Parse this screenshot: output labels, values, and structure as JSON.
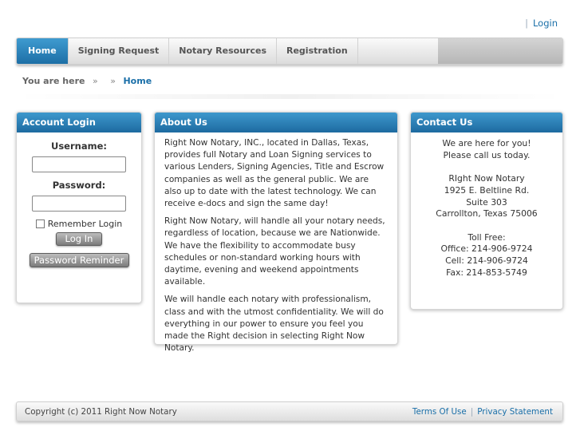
{
  "top_links": {
    "login": "Login"
  },
  "nav": {
    "tabs": [
      {
        "label": "Home",
        "active": true
      },
      {
        "label": "Signing Request",
        "active": false
      },
      {
        "label": "Notary Resources",
        "active": false
      },
      {
        "label": "Registration",
        "active": false
      }
    ]
  },
  "breadcrumb": {
    "label": "You are here",
    "separator": "»",
    "current": "Home"
  },
  "login_box": {
    "title": "Account Login",
    "username_label": "Username:",
    "username_value": "",
    "password_label": "Password:",
    "password_value": "",
    "remember_label": "Remember Login",
    "login_button": "Log In",
    "reminder_button": "Password Reminder"
  },
  "about_box": {
    "title": "About Us",
    "paragraphs": [
      "Right Now Notary, INC., located in Dallas, Texas, provides full Notary and Loan Signing services to various Lenders, Signing Agencies, Title and Escrow companies as well as the general public. We are also up to date with the latest technology. We can receive e-docs and sign the same day!",
      "Right Now Notary, will handle all your notary needs, regardless of location, because we are Nationwide. We have the flexibility to accommodate busy schedules or non-standard working hours with daytime, evening and weekend appointments available.",
      "We will handle each notary with professionalism, class and with the utmost confidentiality. We will do everything in our power to ensure you feel you made the Right decision in selecting Right Now Notary."
    ]
  },
  "contact_box": {
    "title": "Contact Us",
    "line1": "We are here for you!",
    "line2": "Please call us today.",
    "company": "RIght Now Notary",
    "address1": "1925 E. Beltline Rd.",
    "address2": "Suite 303",
    "city": "Carrollton, Texas 75006",
    "toll_label": "Toll Free:",
    "office": "Office: 214-906-9724",
    "cell": "Cell: 214-906-9724",
    "fax": "Fax: 214-853-5749"
  },
  "footer": {
    "copyright": "Copyright (c) 2011 Right Now Notary",
    "terms": "Terms Of Use",
    "privacy": "Privacy Statement"
  },
  "colors": {
    "accent": "#1d6fa6",
    "link": "#1a6fa8"
  }
}
